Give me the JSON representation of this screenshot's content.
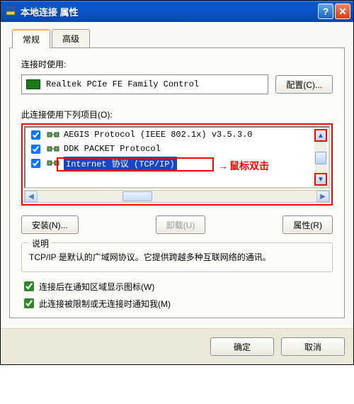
{
  "window": {
    "title": "本地连接 属性"
  },
  "tabs": {
    "general": "常规",
    "advanced": "高级"
  },
  "connect_using_label": "连接时使用:",
  "adapter_name": "Realtek PCIe FE Family Control",
  "configure_btn": "配置(C)...",
  "items_label": "此连接使用下列项目(O):",
  "items": [
    {
      "label": "AEGIS Protocol (IEEE 802.1x) v3.5.3.0",
      "checked": true
    },
    {
      "label": "DDK PACKET Protocol",
      "checked": true
    },
    {
      "label": "Internet 协议 (TCP/IP)",
      "checked": true
    }
  ],
  "callout_text": "鼠标双击",
  "install_btn": "安装(N)...",
  "uninstall_btn": "卸载(U)",
  "properties_btn": "属性(R)",
  "desc_legend": "说明",
  "desc_text": "TCP/IP 是默认的广域网协议。它提供跨越多种互联网络的通讯。",
  "show_tray": "连接后在通知区域显示图标(W)",
  "notify_limited": "此连接被限制或无连接时通知我(M)",
  "ok_btn": "确定",
  "cancel_btn": "取消"
}
